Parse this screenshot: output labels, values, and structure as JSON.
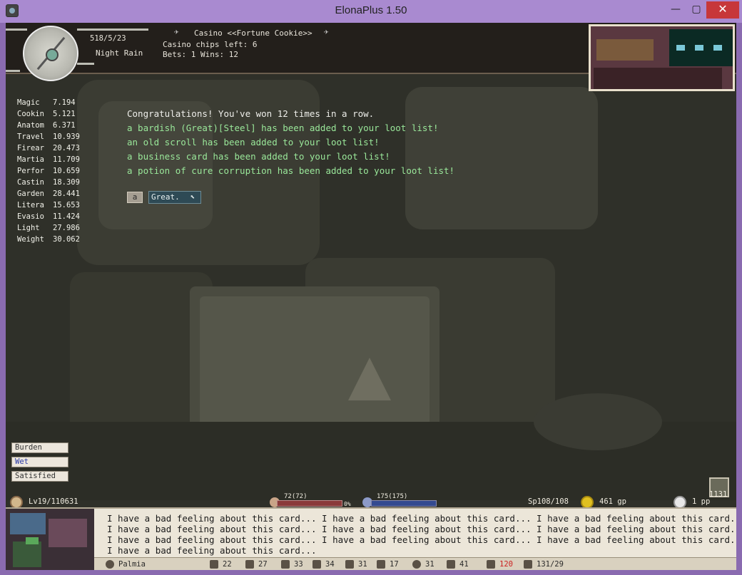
{
  "window": {
    "title": "ElonaPlus 1.50",
    "minimize": "—",
    "maximize": "▢",
    "close": "✕"
  },
  "hud": {
    "date": "518/5/23",
    "time_weather": "Night Rain",
    "location_title": "Casino <<Fortune Cookie>>",
    "chips_left": "Casino chips left: 6",
    "bets_wins": "Bets: 1 Wins: 12"
  },
  "skills": [
    {
      "name": "Magic",
      "value": "7.194"
    },
    {
      "name": "Cookin",
      "value": "5.121"
    },
    {
      "name": "Anatom",
      "value": "6.371"
    },
    {
      "name": "Travel",
      "value": "10.939"
    },
    {
      "name": "Firear",
      "value": "20.473"
    },
    {
      "name": "Martia",
      "value": "11.709"
    },
    {
      "name": "Perfor",
      "value": "10.659"
    },
    {
      "name": "Castin",
      "value": "18.309"
    },
    {
      "name": "Garden",
      "value": "28.441"
    },
    {
      "name": "Litera",
      "value": "15.653"
    },
    {
      "name": "Evasio",
      "value": "11.424"
    },
    {
      "name": "Light",
      "value": "27.986"
    },
    {
      "name": "Weight",
      "value": "30.062"
    }
  ],
  "messages": {
    "congrats": "Congratulations! You've won 12 times in a row.",
    "loot": [
      "a bardish (Great)[Steel] has been added to your loot list!",
      "an old scroll has been added to your loot list!",
      "a business card has been added to your loot list!",
      "a potion of cure corruption has been added to your loot list!"
    ]
  },
  "choice": {
    "key": "a",
    "label": "Great.",
    "arrow": "⬉"
  },
  "status": [
    "Burden",
    "Wet",
    "Satisfied"
  ],
  "stats": {
    "level": "Lv19/110631",
    "hp": "72(72)",
    "hp_percent": "0%",
    "mp": "175(175)",
    "sp": "Sp108/108",
    "gold": "461 gp",
    "platinum": "1 pp",
    "turns": "1131"
  },
  "log": [
    "I have a bad feeling about this card... I have a bad feeling about this card... I have a bad feeling about this card...",
    "I have a bad feeling about this card... I have a bad feeling about this card... I have a bad feeling about this card...",
    "I have a bad feeling about this card... I have a bad feeling about this card... I have a bad feeling about this card...",
    "I have a bad feeling about this card..."
  ],
  "bottom": {
    "town": "Palmia",
    "attrs": [
      "22",
      "27",
      "33",
      "34",
      "31",
      "17",
      "31",
      "41",
      "120",
      "131/29"
    ]
  },
  "colors": {
    "green_msg": "#9ae89a",
    "speed_red": "#cc2222"
  }
}
